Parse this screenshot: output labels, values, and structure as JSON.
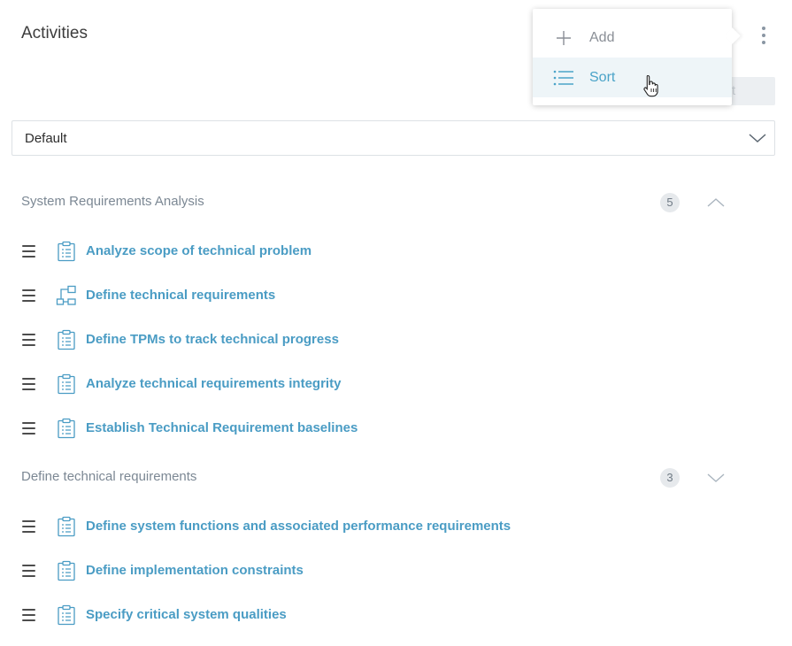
{
  "header": {
    "title": "Activities",
    "more_icon": "kebab-vertical-icon",
    "partial_button_text": "rt"
  },
  "menu": {
    "items": [
      {
        "label": "Add",
        "icon": "plus-icon"
      },
      {
        "label": "Sort",
        "icon": "list-icon"
      }
    ]
  },
  "filter": {
    "value": "Default",
    "icon": "chevron-down-icon"
  },
  "groups": [
    {
      "title": "System Requirements Analysis",
      "count": "5",
      "expanded": true,
      "items": [
        {
          "label": "Analyze scope of technical problem",
          "icon": "clipboard-icon"
        },
        {
          "label": "Define technical requirements",
          "icon": "workflow-icon"
        },
        {
          "label": "Define TPMs to track technical progress",
          "icon": "clipboard-icon"
        },
        {
          "label": "Analyze technical requirements integrity",
          "icon": "clipboard-icon"
        },
        {
          "label": "Establish Technical Requirement baselines",
          "icon": "clipboard-icon"
        }
      ]
    },
    {
      "title": "Define technical requirements",
      "count": "3",
      "expanded": false,
      "items": [
        {
          "label": "Define system functions and associated performance requirements",
          "icon": "clipboard-icon"
        },
        {
          "label": "Define implementation constraints",
          "icon": "clipboard-icon"
        },
        {
          "label": "Specify critical system qualities",
          "icon": "clipboard-icon"
        }
      ]
    }
  ],
  "colors": {
    "accent": "#4a9cc4",
    "muted": "#7c8894",
    "menu_active_bg": "#eef5f8"
  }
}
